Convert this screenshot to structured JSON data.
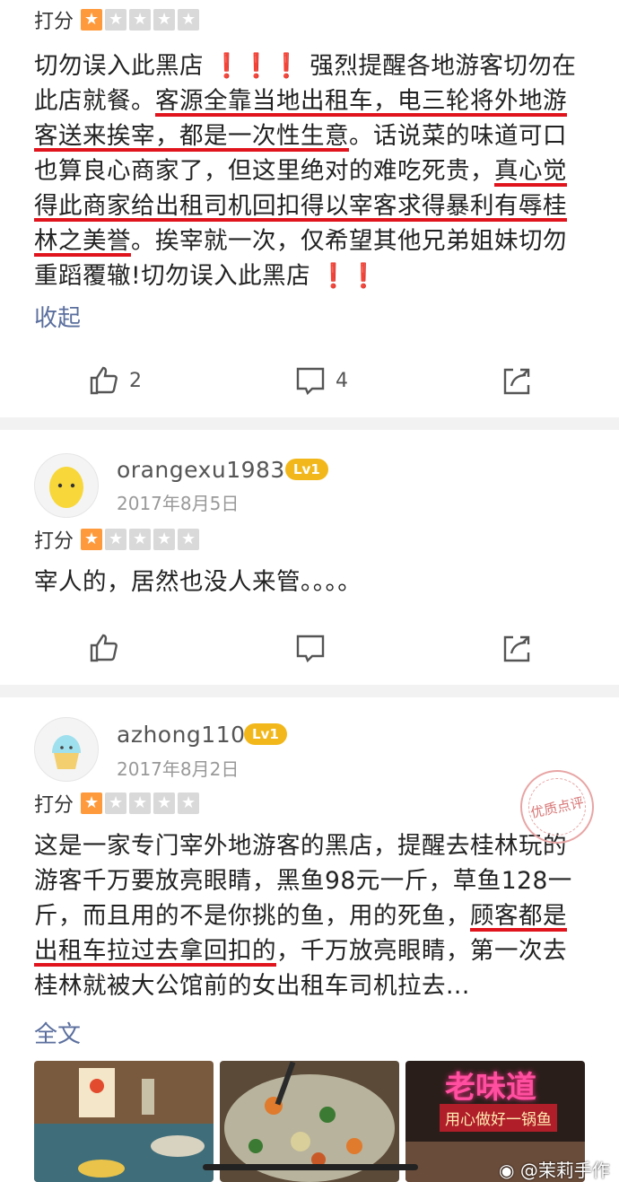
{
  "review1": {
    "rating_label": "打分",
    "body_parts": [
      "切勿误入此黑店",
      "强烈提醒各地游客切勿在此店就餐。",
      "客源全靠当地出租车，电三轮将外地游客送来挨宰，都是一次性生意",
      "。话说菜的味道可口也算良心商家了，但这里绝对的难吃死贵，",
      "真心觉得此商家给出租司机回扣得以宰客求得暴利有辱桂林之美誉",
      "。挨宰就一次，仅希望其他兄弟姐妹切勿重蹈覆辙!切勿误入此黑店"
    ],
    "collapse_label": "收起",
    "like_count": "2",
    "comment_count": "4"
  },
  "review2": {
    "username": "orangexu1983",
    "level": "Lv1",
    "date": "2017年8月5日",
    "rating_label": "打分",
    "body": "宰人的，居然也没人来管。。。。"
  },
  "review3": {
    "username": "azhong110",
    "level": "Lv1",
    "date": "2017年8月2日",
    "rating_label": "打分",
    "body_parts": [
      "这是一家专门宰外地游客的黑店，提醒去桂林玩的游客千万要放亮眼睛，黑鱼98元一斤，草鱼128一斤，而且用的不是你挑的鱼，用的死鱼，",
      "顾客都是出租车拉过去拿回扣的",
      "，千万放亮眼睛，第一次去桂林就被大公馆前的女出租车司机拉去..."
    ],
    "fulltext_label": "全文",
    "stamp_text": "优质点评",
    "photo3_sign_top": "老味道",
    "photo3_sign_bottom": "用心做好一锅鱼"
  },
  "rating": {
    "stars_total": 5,
    "stars_filled": 1
  },
  "watermark": "@茉莉手作",
  "colors": {
    "star_on": "#ff9a3c",
    "star_off": "#d9d9d9",
    "underline": "#e0141c",
    "link": "#5b6f9e",
    "level_badge": "#f2b81b"
  },
  "icons": [
    "thumbs-up-icon",
    "comment-icon",
    "share-icon",
    "star-icon",
    "weibo-icon"
  ]
}
